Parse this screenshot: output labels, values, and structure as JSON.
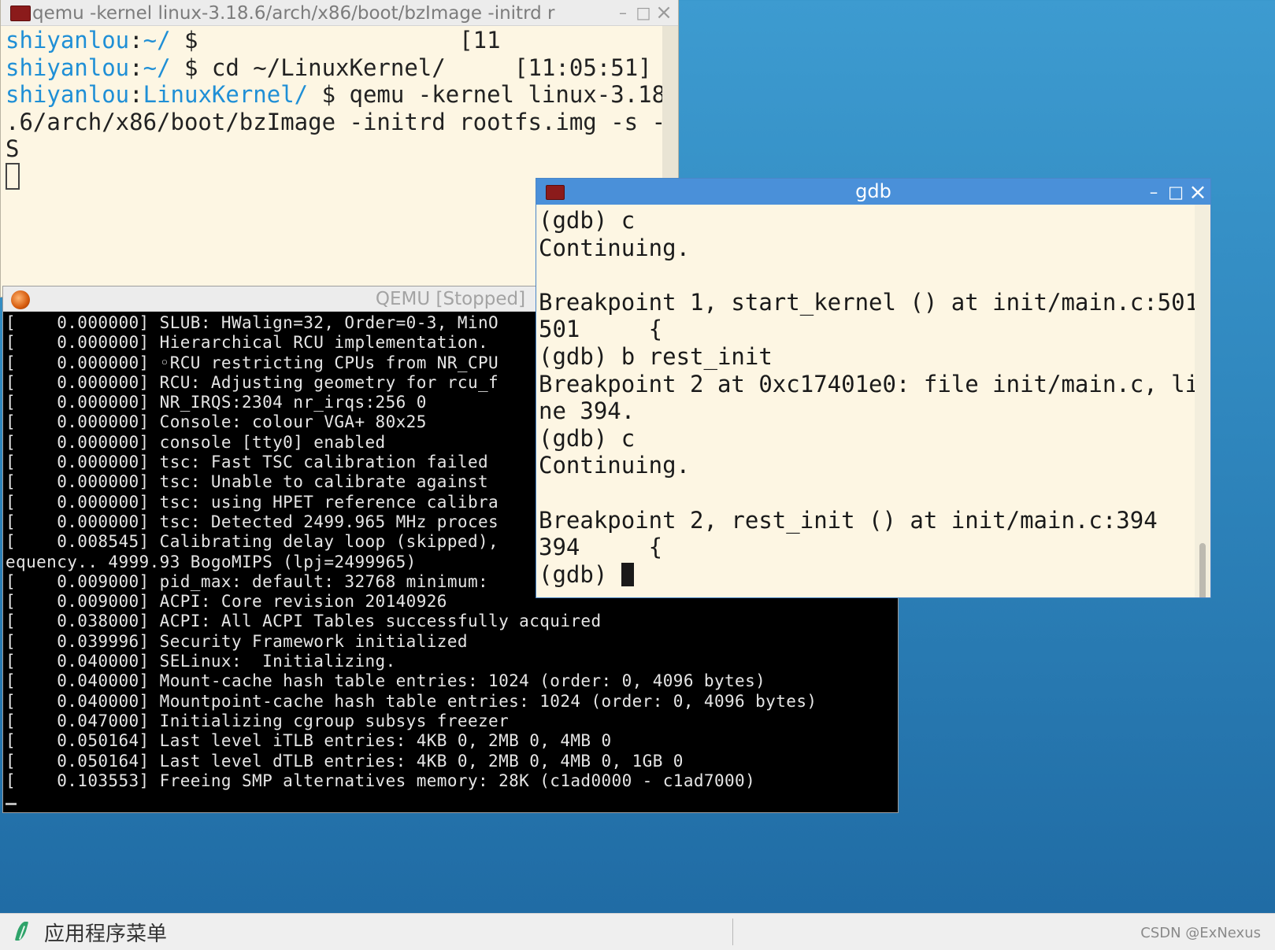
{
  "qemu_terminal": {
    "title": "qemu -kernel linux-3.18.6/arch/x86/boot/bzImage -initrd r",
    "controls": {
      "minimize": "–",
      "maximize": "□",
      "close": "×"
    },
    "prompt_user": "shiyanlou",
    "sep": ":",
    "line1_dir": "~/",
    "line1_cmd": " $",
    "line1_time": "                   [11",
    "line2_dir": "~/",
    "line2_cmd": " $ cd ~/LinuxKernel/     [11:05:51]",
    "line3_dir": "LinuxKernel/",
    "line3_cmd": " $ qemu -kernel linux-3.18",
    "line4": ".6/arch/x86/boot/bzImage -initrd rootfs.img -s -",
    "line5": "S"
  },
  "qemu_window": {
    "title": "QEMU [Stopped]",
    "console_lines": [
      "[    0.000000] SLUB: HWalign=32, Order=0-3, MinO",
      "[    0.000000] Hierarchical RCU implementation.",
      "[    0.000000] ◦RCU restricting CPUs from NR_CPU",
      "[    0.000000] RCU: Adjusting geometry for rcu_f",
      "[    0.000000] NR_IRQS:2304 nr_irqs:256 0",
      "[    0.000000] Console: colour VGA+ 80x25",
      "[    0.000000] console [tty0] enabled",
      "[    0.000000] tsc: Fast TSC calibration failed",
      "[    0.000000] tsc: Unable to calibrate against",
      "[    0.000000] tsc: using HPET reference calibra",
      "[    0.000000] tsc: Detected 2499.965 MHz proces",
      "[    0.008545] Calibrating delay loop (skipped),",
      "equency.. 4999.93 BogoMIPS (lpj=2499965)",
      "[    0.009000] pid_max: default: 32768 minimum:",
      "[    0.009000] ACPI: Core revision 20140926",
      "[    0.038000] ACPI: All ACPI Tables successfully acquired",
      "[    0.039996] Security Framework initialized",
      "[    0.040000] SELinux:  Initializing.",
      "[    0.040000] Mount-cache hash table entries: 1024 (order: 0, 4096 bytes)",
      "[    0.040000] Mountpoint-cache hash table entries: 1024 (order: 0, 4096 bytes)",
      "[    0.047000] Initializing cgroup subsys freezer",
      "[    0.050164] Last level iTLB entries: 4KB 0, 2MB 0, 4MB 0",
      "[    0.050164] Last level dTLB entries: 4KB 0, 2MB 0, 4MB 0, 1GB 0",
      "[    0.103553] Freeing SMP alternatives memory: 28K (c1ad0000 - c1ad7000)"
    ]
  },
  "gdb_window": {
    "title": "gdb",
    "controls": {
      "minimize": "–",
      "maximize": "□",
      "close": "×"
    },
    "lines": [
      "(gdb) c",
      "Continuing.",
      "",
      "Breakpoint 1, start_kernel () at init/main.c:501",
      "501     {",
      "(gdb) b rest_init",
      "Breakpoint 2 at 0xc17401e0: file init/main.c, li",
      "ne 394.",
      "(gdb) c",
      "Continuing.",
      "",
      "Breakpoint 2, rest_init () at init/main.c:394",
      "394     {"
    ],
    "prompt": "(gdb) "
  },
  "taskbar": {
    "menu_label": "应用程序菜单",
    "watermark": "CSDN @ExNexus"
  }
}
